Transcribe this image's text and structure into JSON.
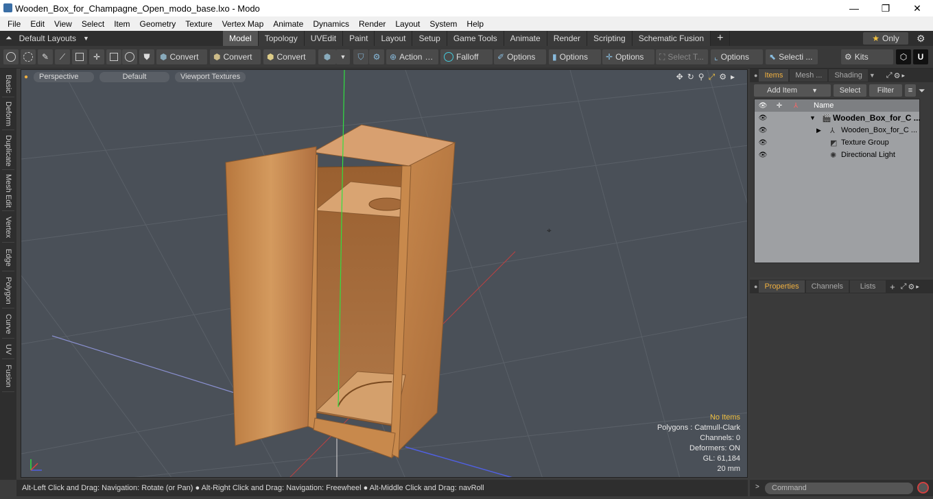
{
  "window": {
    "title": "Wooden_Box_for_Champagne_Open_modo_base.lxo - Modo",
    "minimize": "—",
    "maximize": "❐",
    "close": "✕"
  },
  "menu": [
    "File",
    "Edit",
    "View",
    "Select",
    "Item",
    "Geometry",
    "Texture",
    "Vertex Map",
    "Animate",
    "Dynamics",
    "Render",
    "Layout",
    "System",
    "Help"
  ],
  "layout_bar": {
    "default_layouts": "Default Layouts",
    "tabs": [
      "Model",
      "Topology",
      "UVEdit",
      "Paint",
      "Layout",
      "Setup",
      "Game Tools",
      "Animate",
      "Render",
      "Scripting",
      "Schematic Fusion"
    ],
    "active_tab": "Model",
    "add": "+",
    "only": "Only"
  },
  "toolbar": {
    "convert1": "Convert",
    "convert2": "Convert",
    "convert3": "Convert",
    "action": "Action",
    "falloff": "Falloff",
    "options1": "Options",
    "options2": "Options",
    "options3": "Options",
    "select_t": "Select T...",
    "options4": "Options",
    "selecti": "Selecti ...",
    "kits": "Kits"
  },
  "left_tabs": [
    "Basic",
    "Deform",
    "Duplicate",
    "Mesh Edit",
    "Vertex",
    "Edge",
    "Polygon",
    "Curve",
    "UV",
    "Fusion"
  ],
  "viewport": {
    "perspective": "Perspective",
    "default": "Default",
    "textures": "Viewport Textures",
    "info": {
      "no_items": "No Items",
      "polygons": "Polygons : Catmull-Clark",
      "channels": "Channels: 0",
      "deformers": "Deformers: ON",
      "gl": "GL: 61,184",
      "scale": "20 mm"
    }
  },
  "status": "Alt-Left Click and Drag: Navigation: Rotate (or Pan) ● Alt-Right Click and Drag: Navigation: Freewheel ● Alt-Middle Click and Drag: navRoll",
  "items_panel": {
    "tabs": [
      "Items",
      "Mesh ...",
      "Shading"
    ],
    "add_item": "Add Item",
    "select": "Select",
    "filter": "Filter",
    "col_name": "Name",
    "rows": [
      {
        "label": "Wooden_Box_for_C ...",
        "indent": 0
      },
      {
        "label": "Wooden_Box_for_C ...",
        "indent": 1
      },
      {
        "label": "Texture Group",
        "indent": 1
      },
      {
        "label": "Directional Light",
        "indent": 1
      }
    ]
  },
  "properties_panel": {
    "tabs": [
      "Properties",
      "Channels",
      "Lists"
    ],
    "add": "+"
  },
  "command": {
    "placeholder": "Command"
  },
  "colors": {
    "accent": "#f0b040",
    "viewport_bg": "#4a5058",
    "wood": "#c8874a"
  }
}
